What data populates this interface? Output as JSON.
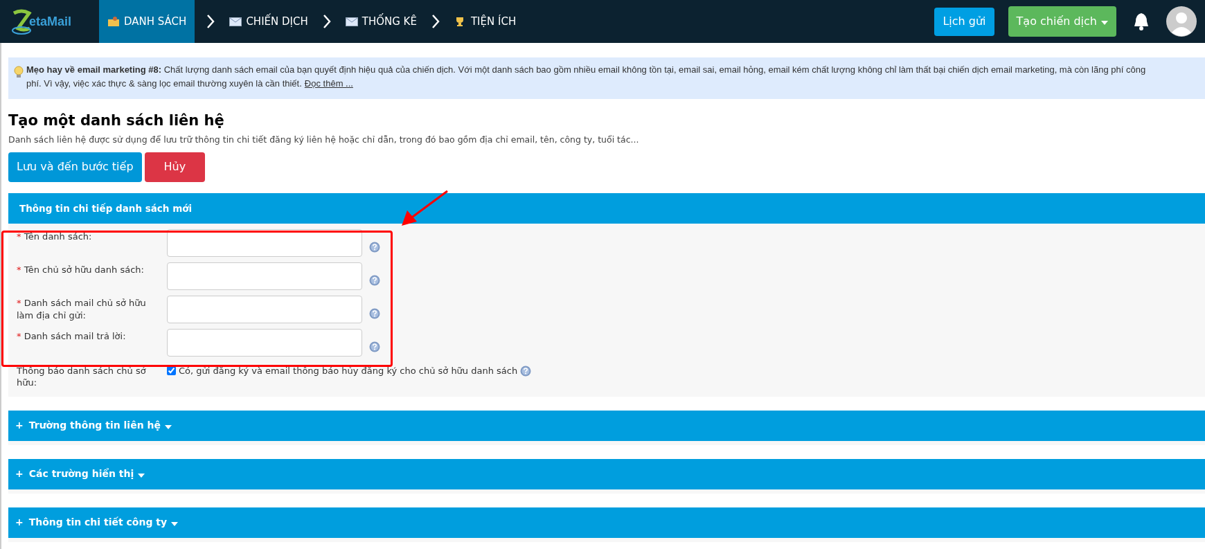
{
  "navbar": {
    "logo": "etaMail",
    "items": [
      {
        "label": "DANH SÁCH",
        "selected": true
      },
      {
        "label": "CHIẾN DỊCH",
        "selected": false
      },
      {
        "label": "THỐNG KÊ",
        "selected": false
      },
      {
        "label": "TIỆN ÍCH",
        "selected": false
      }
    ],
    "schedule_button": "Lịch gửi",
    "create_button": "Tạo chiến dịch"
  },
  "tip": {
    "line_1": "**Mẹo hay về email marketing #8:** Chất lượng danh sách email của bạn quyết định hiệu quả của chiến dịch. Với một danh sách bao gồm nhiều email không tồn tại, email sai, email hỏng, email kém chất lượng không chỉ làm thất bại chiến dịch email marketing, mà còn lãng phí công",
    "line_2": "phí. Vì vậy, việc xác thực & sàng lọc email thường xuyên là cần thiết.",
    "link": "Đọc thêm ..."
  },
  "title": "Tạo một danh sách liên hệ",
  "description": "Danh sách liên hệ được sử dụng để lưu trữ thông tin chi tiết đăng ký liên hệ hoặc chỉ dẫn, trong đó bao gồm địa chỉ email, tên, công ty, tuổi tác...",
  "buttons": {
    "save": "Lưu và đến bước tiếp",
    "cancel": "Hủy"
  },
  "details_panel": {
    "title": "Thông tin chi tiếp danh sách mới",
    "fields": [
      {
        "label": "Tên danh sách:",
        "required": "*"
      },
      {
        "label": "Tên chủ sở hữu danh sách:",
        "required": "*"
      },
      {
        "label": "Danh sách mail chủ sở hữu làm địa chỉ gửi:",
        "required": "*"
      },
      {
        "label": "Danh sách mail trả lời:",
        "required": "*"
      }
    ],
    "notify": {
      "label": "Thông báo danh sách chủ sở hữu:",
      "option": "Có, gửi đăng ký và email thông báo hủy đăng ký cho chủ sở hữu danh sách",
      "checked": true
    }
  },
  "collapsed_sections": [
    {
      "toggle": "+",
      "title": "Trường thông tin liên hệ",
      "expanded": false
    },
    {
      "toggle": "+",
      "title": "Các trường hiển thị",
      "expanded": false
    },
    {
      "toggle": "+",
      "title": "Thông tin chi tiết công ty",
      "expanded": false
    }
  ]
}
